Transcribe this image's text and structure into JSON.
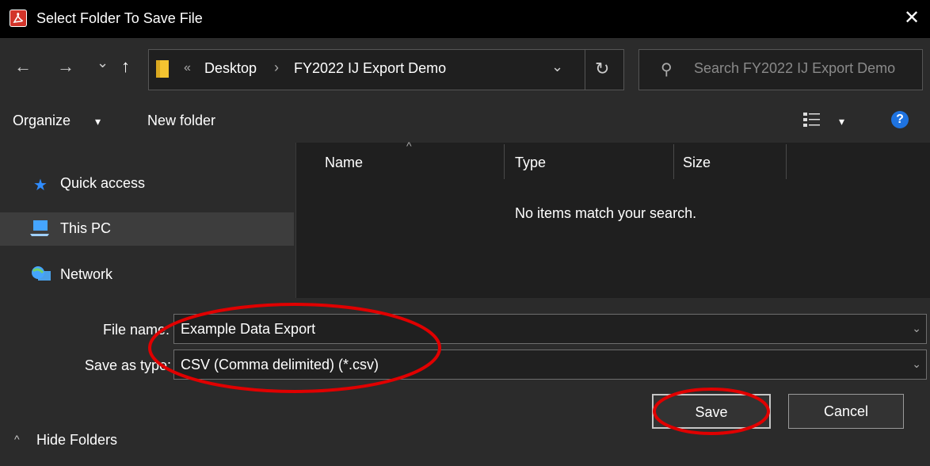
{
  "window": {
    "title": "Select Folder To Save File",
    "close_glyph": "✕",
    "app_icon": "pdf-app-icon"
  },
  "nav": {
    "back_glyph": "←",
    "forward_glyph": "→",
    "recent_glyph": "⌄",
    "up_glyph": "↑",
    "breadcrumb": {
      "separator_glyph": "«",
      "items": [
        "Desktop",
        "FY2022 IJ Export Demo"
      ],
      "arrow_glyph": "›"
    },
    "dropdown_glyph": "⌄",
    "refresh_glyph": "↻",
    "search": {
      "placeholder": "Search FY2022 IJ Export Demo",
      "icon_glyph": "⚲"
    }
  },
  "toolbar": {
    "organize_label": "Organize",
    "organize_arrow": "▾",
    "new_folder_label": "New folder",
    "view_arrow": "▾",
    "help_label": "?"
  },
  "navpane": {
    "items": [
      {
        "label": "Quick access",
        "icon": "★",
        "icon_color": "#2f8cff",
        "selected": false
      },
      {
        "label": "This PC",
        "icon": "💻",
        "icon_color": "#45a5ff",
        "selected": true
      },
      {
        "label": "Network",
        "icon": "🌐",
        "icon_color": "#45a5ff",
        "selected": false
      }
    ]
  },
  "filelist": {
    "columns": [
      "Name",
      "Type",
      "Size"
    ],
    "sort_glyph": "^",
    "empty_message": "No items match your search."
  },
  "form": {
    "file_name_label": "File name:",
    "file_name_value": "Example Data Export",
    "save_as_type_label": "Save as type:",
    "save_as_type_value": "CSV (Comma delimited) (*.csv)",
    "chevron_glyph": "⌄"
  },
  "buttons": {
    "save_label": "Save",
    "cancel_label": "Cancel"
  },
  "footer": {
    "hide_folders_glyph": "^",
    "hide_folders_label": "Hide Folders"
  },
  "colors": {
    "annotation": "#e00000",
    "accent": "#1e73e0",
    "folder": "#f4c431"
  }
}
